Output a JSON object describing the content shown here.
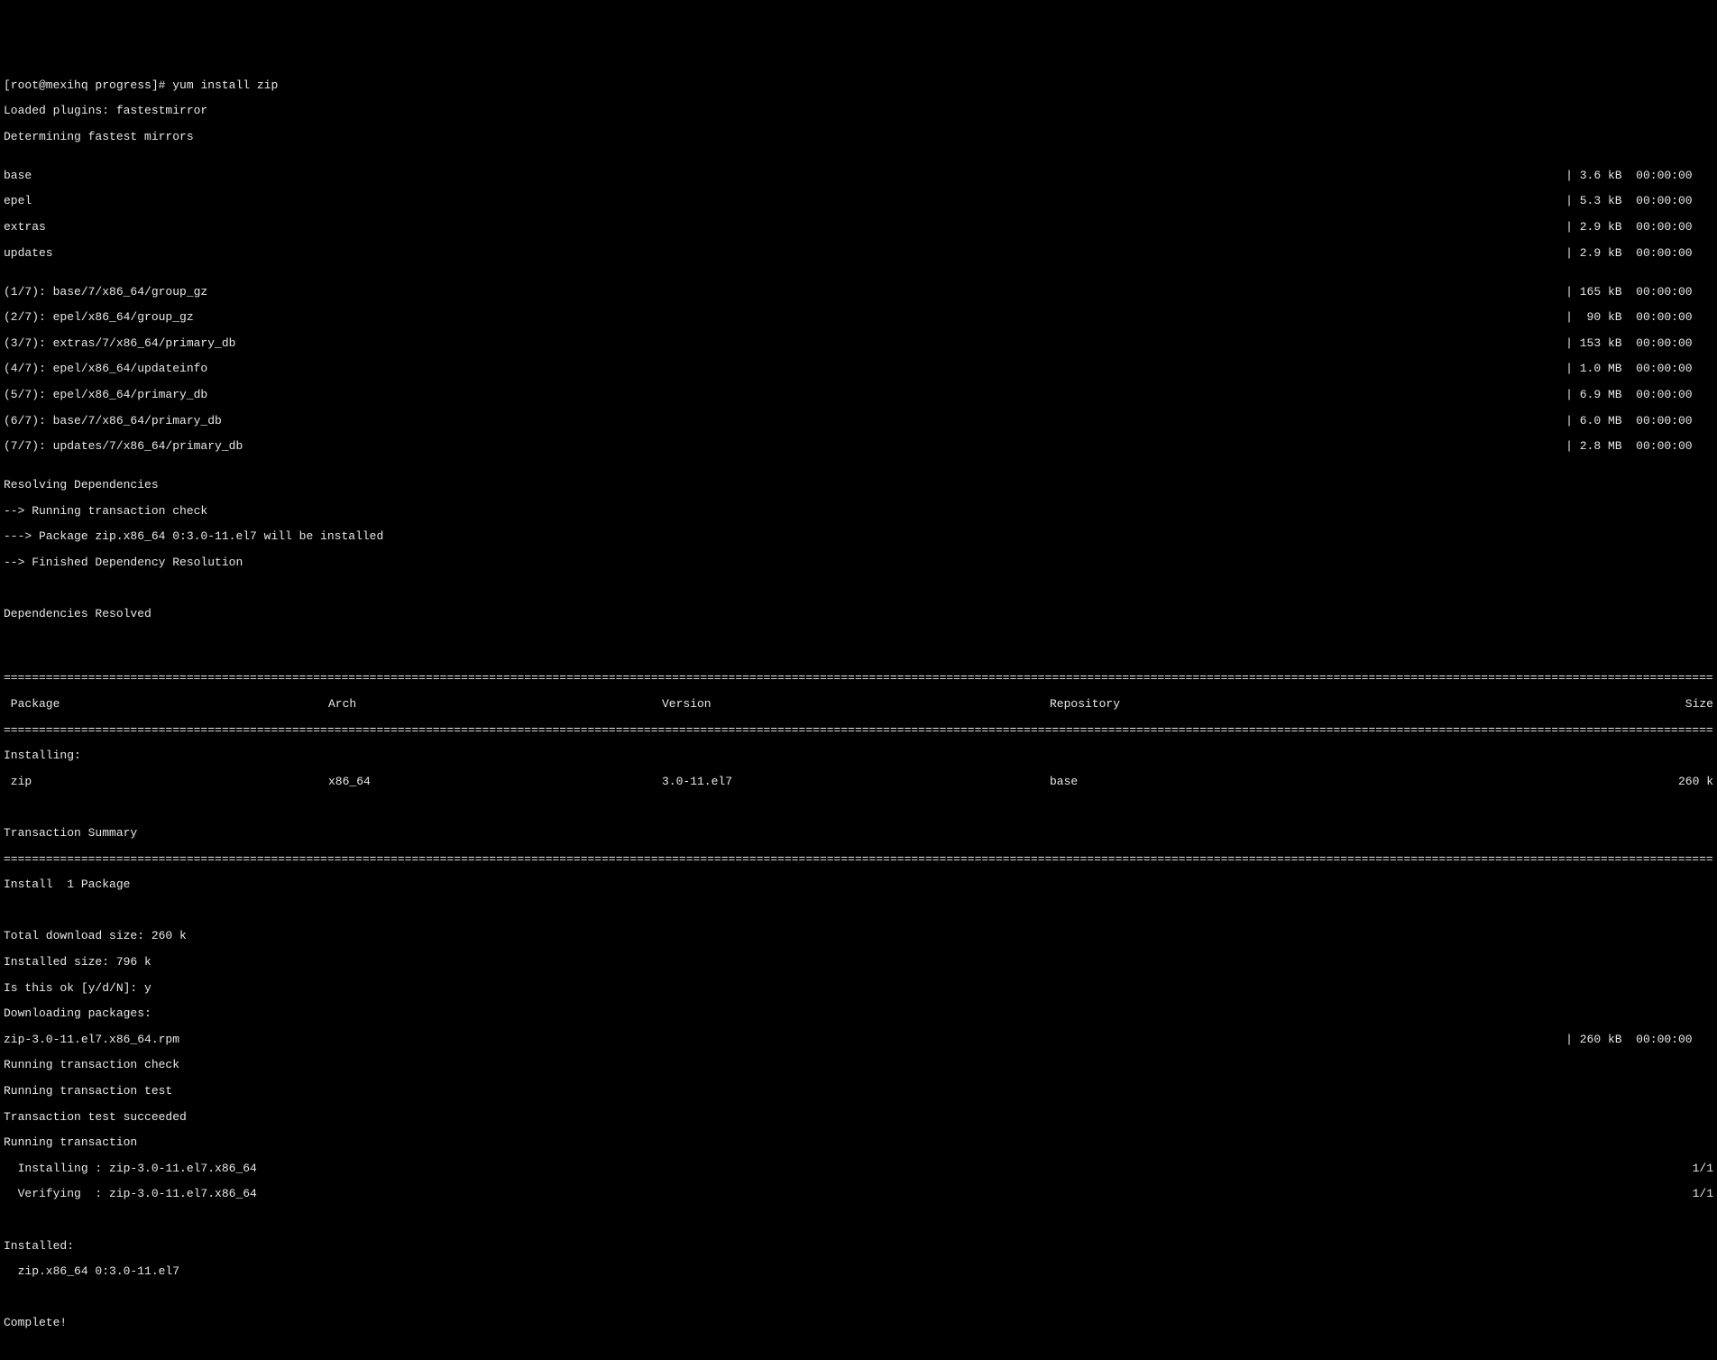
{
  "prompt": {
    "ps1": "[root@mexihq progress]# ",
    "cmd": "yum install zip"
  },
  "lines": {
    "plugins": "Loaded plugins: fastestmirror",
    "determining": "Determining fastest mirrors",
    "repos": [
      {
        "name": "base",
        "size": "3.6 kB",
        "time": "00:00:00"
      },
      {
        "name": "epel",
        "size": "5.3 kB",
        "time": "00:00:00"
      },
      {
        "name": "extras",
        "size": "2.9 kB",
        "time": "00:00:00"
      },
      {
        "name": "updates",
        "size": "2.9 kB",
        "time": "00:00:00"
      }
    ],
    "fetches": [
      {
        "name": "(1/7): base/7/x86_64/group_gz",
        "size": " 165 kB",
        "time": "00:00:00"
      },
      {
        "name": "(2/7): epel/x86_64/group_gz",
        "size": "  90 kB",
        "time": "00:00:00"
      },
      {
        "name": "(3/7): extras/7/x86_64/primary_db",
        "size": " 153 kB",
        "time": "00:00:00"
      },
      {
        "name": "(4/7): epel/x86_64/updateinfo",
        "size": " 1.0 MB",
        "time": "00:00:00"
      },
      {
        "name": "(5/7): epel/x86_64/primary_db",
        "size": " 6.9 MB",
        "time": "00:00:00"
      },
      {
        "name": "(6/7): base/7/x86_64/primary_db",
        "size": " 6.0 MB",
        "time": "00:00:00"
      },
      {
        "name": "(7/7): updates/7/x86_64/primary_db",
        "size": " 2.8 MB",
        "time": "00:00:00"
      }
    ],
    "resolving": "Resolving Dependencies",
    "runcheck": "--> Running transaction check",
    "pkginstalled": "---> Package zip.x86_64 0:3.0-11.el7 will be installed",
    "finished": "--> Finished Dependency Resolution",
    "depresolved": "Dependencies Resolved",
    "hdr": {
      "pkg": " Package",
      "arch": "Arch",
      "ver": "Version",
      "repo": "Repository",
      "size": "Size"
    },
    "installing_hdr": "Installing:",
    "row": {
      "pkg": " zip",
      "arch": "x86_64",
      "ver": "3.0-11.el7",
      "repo": "base",
      "size": "260 k"
    },
    "txsummary": "Transaction Summary",
    "install1": "Install  1 Package",
    "dlsize": "Total download size: 260 k",
    "instsize": "Installed size: 796 k",
    "isok": "Is this ok [y/d/N]: y",
    "dlpkg": "Downloading packages:",
    "rpm": {
      "name": "zip-3.0-11.el7.x86_64.rpm",
      "size": " 260 kB",
      "time": "00:00:00"
    },
    "rtc": "Running transaction check",
    "rtt": "Running transaction test",
    "tts": "Transaction test succeeded",
    "rt": "Running transaction",
    "installing": {
      "label": "  Installing : zip-3.0-11.el7.x86_64",
      "count": "1/1"
    },
    "verifying": {
      "label": "  Verifying  : zip-3.0-11.el7.x86_64",
      "count": "1/1"
    },
    "installedhdr": "Installed:",
    "installedpkg": "  zip.x86_64 0:3.0-11.el7",
    "complete": "Complete!"
  },
  "rule": "================================================================================================================================================================================================================================================================================================================================="
}
